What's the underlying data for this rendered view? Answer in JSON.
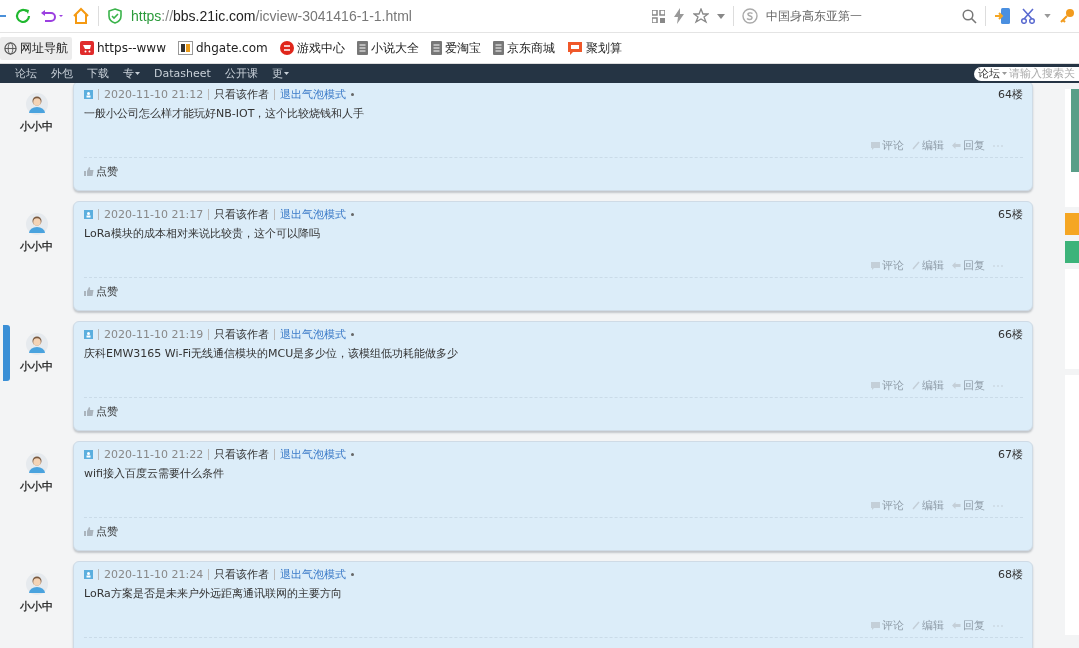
{
  "toolbar": {
    "url": [
      {
        "kind": "scheme",
        "text": "https"
      },
      {
        "kind": "sep",
        "text": "://"
      },
      {
        "kind": "host",
        "text": "bbs.21ic.com"
      },
      {
        "kind": "path",
        "text": "/icview-3041416-1-1.html"
      }
    ],
    "search_placeholder": "中国身高东亚第一"
  },
  "bookmarks": [
    {
      "kind": "globe",
      "label": "网址导航",
      "selected": true
    },
    {
      "kind": "cart",
      "label": "https--www",
      "selected": false
    },
    {
      "kind": "dh",
      "label": "dhgate.com",
      "selected": false
    },
    {
      "kind": "game",
      "label": "游戏中心",
      "selected": false
    },
    {
      "kind": "doc",
      "label": "小说大全",
      "selected": false
    },
    {
      "kind": "doc",
      "label": "爱淘宝",
      "selected": false
    },
    {
      "kind": "doc",
      "label": "京东商城",
      "selected": false
    },
    {
      "kind": "ju",
      "label": "聚划算",
      "selected": false
    }
  ],
  "nav": {
    "items": [
      {
        "label": "论坛",
        "dropdown": false
      },
      {
        "label": "外包",
        "dropdown": false
      },
      {
        "label": "下载",
        "dropdown": false
      },
      {
        "label": "专",
        "dropdown": true
      },
      {
        "label": "Datasheet",
        "dropdown": false
      },
      {
        "label": "公开课",
        "dropdown": false
      },
      {
        "label": "更",
        "dropdown": true
      }
    ],
    "search_scope": "论坛",
    "search_placeholder": "请输入搜索关"
  },
  "posts": [
    {
      "author": "小小中",
      "date": "2020-11-10 21:12",
      "author_only": "只看该作者",
      "exit_bubble": "退出气泡模式",
      "floor": "64楼",
      "content": "一般小公司怎么样才能玩好NB-IOT，这个比较烧钱和人手",
      "actions": [
        "评论",
        "编辑",
        "回复"
      ],
      "like": "点赞"
    },
    {
      "author": "小小中",
      "date": "2020-11-10 21:17",
      "author_only": "只看该作者",
      "exit_bubble": "退出气泡模式",
      "floor": "65楼",
      "content": "LoRa模块的成本相对来说比较贵，这个可以降吗",
      "actions": [
        "评论",
        "编辑",
        "回复"
      ],
      "like": "点赞"
    },
    {
      "author": "小小中",
      "date": "2020-11-10 21:19",
      "author_only": "只看该作者",
      "exit_bubble": "退出气泡模式",
      "floor": "66楼",
      "content": "庆科EMW3165 Wi-Fi无线通信模块的MCU是多少位，该模组低功耗能做多少",
      "actions": [
        "评论",
        "编辑",
        "回复"
      ],
      "like": "点赞"
    },
    {
      "author": "小小中",
      "date": "2020-11-10 21:22",
      "author_only": "只看该作者",
      "exit_bubble": "退出气泡模式",
      "floor": "67楼",
      "content": "wifi接入百度云需要什么条件",
      "actions": [
        "评论",
        "编辑",
        "回复"
      ],
      "like": "点赞"
    },
    {
      "author": "小小中",
      "date": "2020-11-10 21:24",
      "author_only": "只看该作者",
      "exit_bubble": "退出气泡模式",
      "floor": "68楼",
      "content": "LoRa方案是否是未来户外远距离通讯联网的主要方向",
      "actions": [
        "评论",
        "编辑",
        "回复"
      ]
    }
  ]
}
